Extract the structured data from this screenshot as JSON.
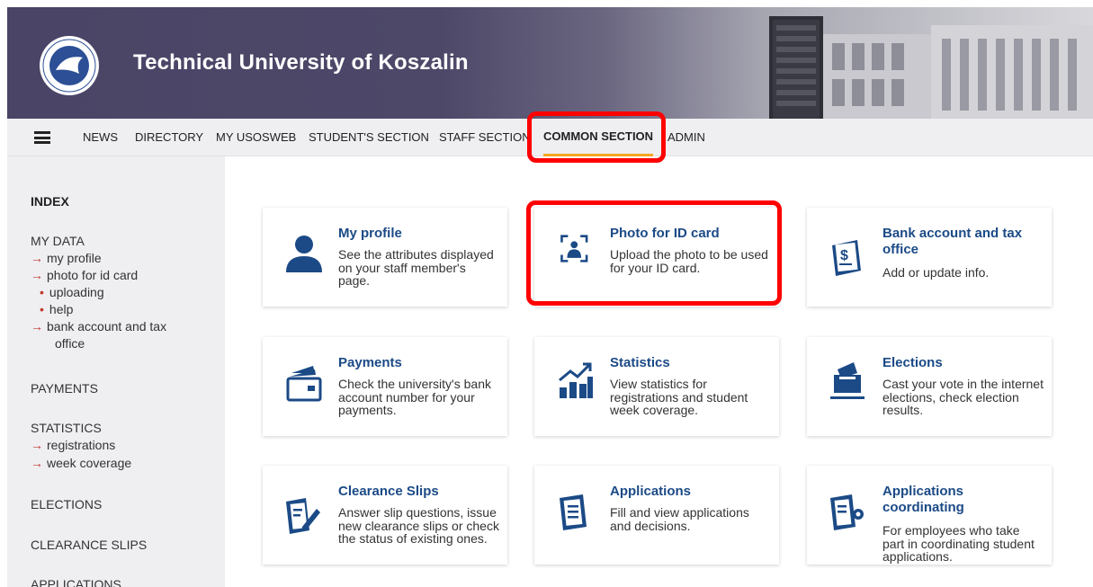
{
  "header": {
    "university_name": "Technical University of Koszalin"
  },
  "nav": {
    "items": [
      "NEWS",
      "DIRECTORY",
      "MY USOSWEB",
      "STUDENT'S SECTION",
      "STAFF SECTION",
      "COMMON SECTION",
      "ADMIN"
    ],
    "active": "COMMON SECTION"
  },
  "sidebar": {
    "index": "INDEX",
    "my_data": "MY DATA",
    "my_profile": "my profile",
    "photo_for_id_card": "photo for id card",
    "uploading": "uploading",
    "help": "help",
    "bank_account_1": "bank account and tax",
    "bank_account_2": "office",
    "payments": "PAYMENTS",
    "statistics": "STATISTICS",
    "registrations": "registrations",
    "week_coverage": "week coverage",
    "elections": "ELECTIONS",
    "clearance_slips": "CLEARANCE SLIPS",
    "applications": "APPLICATIONS"
  },
  "cards": [
    {
      "title": "My profile",
      "desc": "See the attributes displayed on your staff member's page.",
      "icon": "user-icon"
    },
    {
      "title": "Photo for ID card",
      "desc": "Upload the photo to be used for your ID card.",
      "icon": "id-photo-icon"
    },
    {
      "title": "Bank account and tax office",
      "desc": "Add or update info.",
      "icon": "bank-document-icon"
    },
    {
      "title": "Payments",
      "desc": "Check the university's bank account number for your payments.",
      "icon": "wallet-icon"
    },
    {
      "title": "Statistics",
      "desc": "View statistics for registrations and student week coverage.",
      "icon": "chart-growth-icon"
    },
    {
      "title": "Elections",
      "desc": "Cast your vote in the internet elections, check election results.",
      "icon": "ballot-box-icon"
    },
    {
      "title": "Clearance Slips",
      "desc": "Answer slip questions, issue new clearance slips or check the status of existing ones.",
      "icon": "edit-document-icon"
    },
    {
      "title": "Applications",
      "desc": "Fill and view applications and decisions.",
      "icon": "document-icon"
    },
    {
      "title": "Applications coordinating",
      "desc": "For employees who take part in coordinating student applications.",
      "icon": "document-settings-icon"
    }
  ],
  "colors": {
    "accent": "#1b4a86",
    "header_bg": "#4a4466",
    "highlight": "#ff0000",
    "active_underline": "#f5a623",
    "arrow": "#c0392b"
  }
}
